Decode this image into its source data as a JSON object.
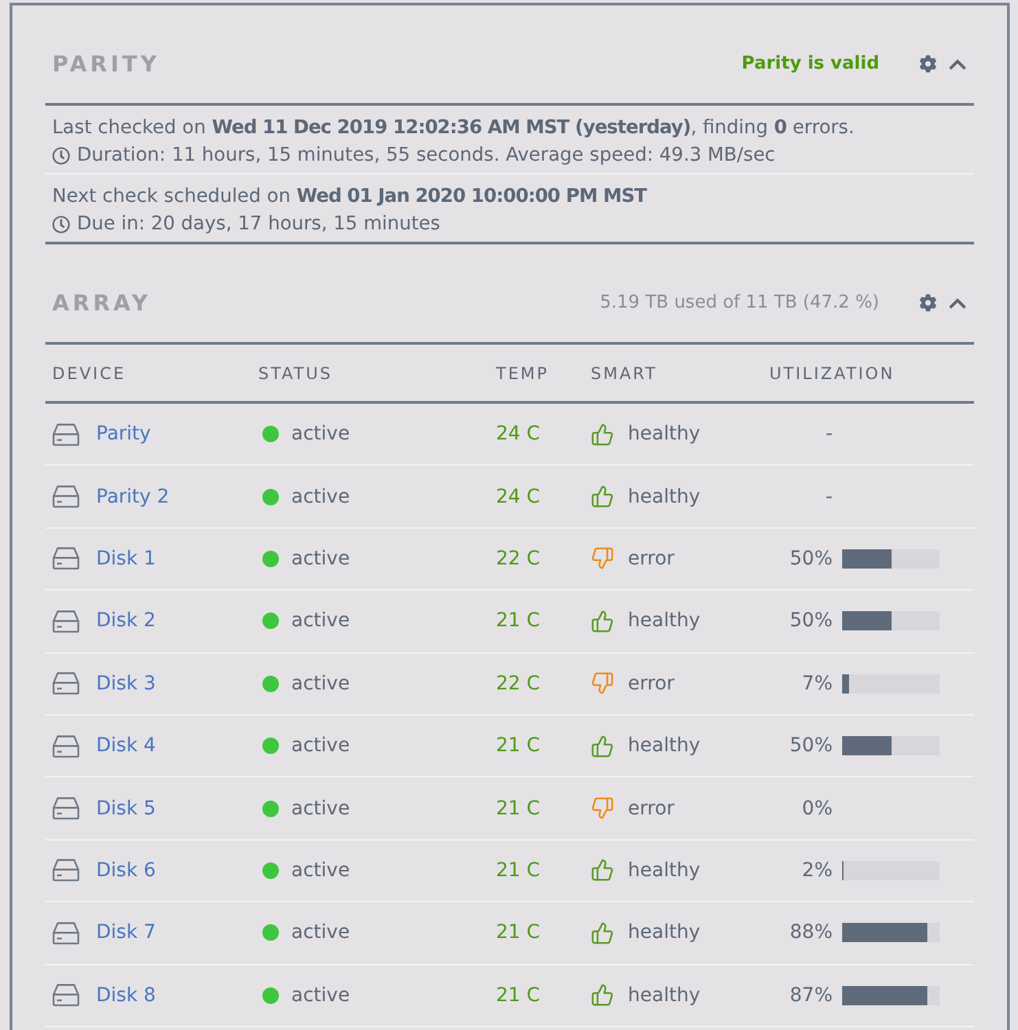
{
  "parity": {
    "title": "PARITY",
    "status": "Parity is valid",
    "expanded": true,
    "entries": [
      {
        "text": "Last checked on **Wed 11 Dec 2019 12:02:36 AM MST (yesterday)**, finding **0** errors.",
        "detail": "Duration: 11 hours, 15 minutes, 55 seconds. Average speed: 49.3 MB/sec"
      },
      {
        "text": "Next check scheduled on **Wed 01 Jan 2020 10:00:00 PM MST**",
        "detail": "Due in: 20 days, 17 hours, 15 minutes"
      }
    ]
  },
  "array": {
    "title": "ARRAY",
    "summary": "5.19 TB used of 11 TB (47.2 %)",
    "expanded": true,
    "columns": [
      "DEVICE",
      "STATUS",
      "TEMP",
      "SMART",
      "UTILIZATION"
    ],
    "rows": [
      {
        "device": "Parity",
        "status": "active",
        "color": "#3fc63f",
        "temp": "24 C",
        "smart": "healthy",
        "smart_ok": true,
        "utilization": "-"
      },
      {
        "device": "Parity 2",
        "status": "active",
        "color": "#3fc63f",
        "temp": "24 C",
        "smart": "healthy",
        "smart_ok": true,
        "utilization": "-"
      },
      {
        "device": "Disk 1",
        "status": "active",
        "color": "#3fc63f",
        "temp": "22 C",
        "smart": "error",
        "smart_ok": false,
        "utilization": "50%",
        "level": 0.5
      },
      {
        "device": "Disk 2",
        "status": "active",
        "color": "#3fc63f",
        "temp": "21 C",
        "smart": "healthy",
        "smart_ok": true,
        "utilization": "50%",
        "level": 0.5
      },
      {
        "device": "Disk 3",
        "status": "active",
        "color": "#3fc63f",
        "temp": "22 C",
        "smart": "error",
        "smart_ok": false,
        "utilization": "7%",
        "level": 0.07
      },
      {
        "device": "Disk 4",
        "status": "active",
        "color": "#3fc63f",
        "temp": "21 C",
        "smart": "healthy",
        "smart_ok": true,
        "utilization": "50%",
        "level": 0.5
      },
      {
        "device": "Disk 5",
        "status": "active",
        "color": "#3fc63f",
        "temp": "21 C",
        "smart": "error",
        "smart_ok": false,
        "utilization": "0%"
      },
      {
        "device": "Disk 6",
        "status": "active",
        "color": "#3fc63f",
        "temp": "21 C",
        "smart": "healthy",
        "smart_ok": true,
        "utilization": "2%",
        "level": 0.02
      },
      {
        "device": "Disk 7",
        "status": "active",
        "color": "#3fc63f",
        "temp": "21 C",
        "smart": "healthy",
        "smart_ok": true,
        "utilization": "88%",
        "level": 0.88
      },
      {
        "device": "Disk 8",
        "status": "active",
        "color": "#3fc63f",
        "temp": "21 C",
        "smart": "healthy",
        "smart_ok": true,
        "utilization": "87%",
        "level": 0.87
      }
    ]
  }
}
